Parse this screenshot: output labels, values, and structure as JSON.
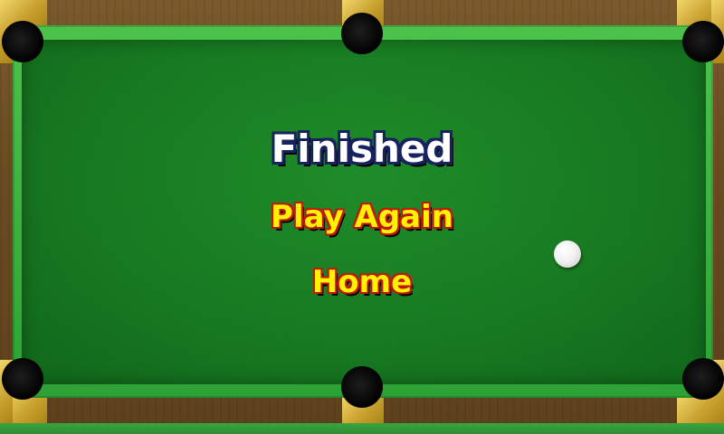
{
  "game": {
    "title": "Finished",
    "menu": {
      "play_again_label": "Play Again",
      "home_label": "Home"
    }
  },
  "colors": {
    "felt": "#187c22",
    "rail": "#2da234",
    "wood": "#6b4b22",
    "gold_plate": "#c9a230",
    "title_text": "#ffffff",
    "title_outline": "#16235f",
    "button_text": "#fff200",
    "button_outline": "#c0180c"
  },
  "table": {
    "pockets": [
      "top-left",
      "top-center",
      "top-right",
      "bottom-left",
      "bottom-center",
      "bottom-right"
    ],
    "balls": [
      "cue-ball"
    ]
  }
}
